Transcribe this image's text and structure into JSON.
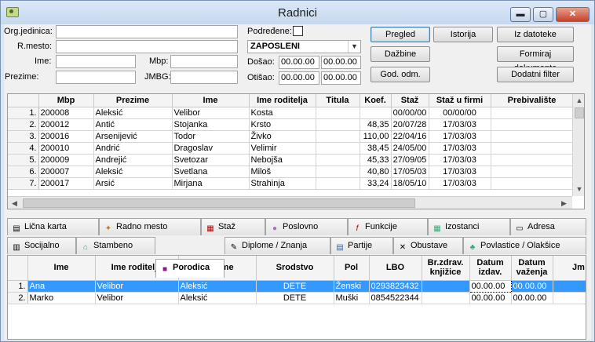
{
  "window": {
    "title": "Radnici",
    "min": "▬",
    "max": "▢",
    "close": "✕"
  },
  "filters": {
    "org_label": "Org.jedinica:",
    "org_value": "",
    "rmesto_label": "R.mesto:",
    "rmesto_value": "",
    "ime_label": "Ime:",
    "ime_value": "",
    "mbp_label": "Mbp:",
    "mbp_value": "",
    "prezime_label": "Prezime:",
    "prezime_value": "",
    "jmbg_label": "JMBG:",
    "jmbg_value": "",
    "podredjene_label": "Podređene:",
    "status_value": "ZAPOSLENI",
    "dosao_label": "Došao:",
    "dosao_from": "00.00.00",
    "dosao_to": "00.00.00",
    "otisao_label": "Otišao:",
    "otisao_from": "00.00.00",
    "otisao_to": "00.00.00"
  },
  "buttons": {
    "pregled": "Pregled",
    "istorija": "Istorija",
    "iz_datoteke": "Iz datoteke",
    "dazbine": "Dažbine",
    "formiraj": "Formiraj dokumente",
    "god_odm": "God. odm.",
    "dodatni": "Dodatni filter"
  },
  "main_table": {
    "headers": [
      "Mbp",
      "Prezime",
      "Ime",
      "Ime roditelja",
      "Titula",
      "Koef.",
      "Staž",
      "Staž u firmi",
      "Prebivalište"
    ],
    "rows": [
      {
        "n": "1.",
        "mbp": "200008",
        "prezime": "Aleksić",
        "ime": "Velibor",
        "roditelj": "Kosta",
        "titula": "",
        "koef": "",
        "staz": "00/00/00",
        "staz_firma": "00/00/00",
        "preb": ""
      },
      {
        "n": "2.",
        "mbp": "200012",
        "prezime": "Antić",
        "ime": "Stojanka",
        "roditelj": "Krsto",
        "titula": "",
        "koef": "48,35",
        "staz": "20/07/28",
        "staz_firma": "17/03/03",
        "preb": ""
      },
      {
        "n": "3.",
        "mbp": "200016",
        "prezime": "Arsenijević",
        "ime": "Todor",
        "roditelj": "Živko",
        "titula": "",
        "koef": "110,00",
        "staz": "22/04/16",
        "staz_firma": "17/03/03",
        "preb": ""
      },
      {
        "n": "4.",
        "mbp": "200010",
        "prezime": "Andrić",
        "ime": "Dragoslav",
        "roditelj": "Velimir",
        "titula": "",
        "koef": "38,45",
        "staz": "24/05/00",
        "staz_firma": "17/03/03",
        "preb": ""
      },
      {
        "n": "5.",
        "mbp": "200009",
        "prezime": "Andrejić",
        "ime": "Svetozar",
        "roditelj": "Nebojša",
        "titula": "",
        "koef": "45,33",
        "staz": "27/09/05",
        "staz_firma": "17/03/03",
        "preb": ""
      },
      {
        "n": "6.",
        "mbp": "200007",
        "prezime": "Aleksić",
        "ime": "Svetlana",
        "roditelj": "Miloš",
        "titula": "",
        "koef": "40,80",
        "staz": "17/05/03",
        "staz_firma": "17/03/03",
        "preb": ""
      },
      {
        "n": "7.",
        "mbp": "200017",
        "prezime": "Arsić",
        "ime": "Mirjana",
        "roditelj": "Strahinja",
        "titula": "",
        "koef": "33,24",
        "staz": "18/05/10",
        "staz_firma": "17/03/03",
        "preb": ""
      }
    ]
  },
  "tabs_row1": [
    "Lična karta",
    "Radno mesto",
    "Staž",
    "Poslovno",
    "Funkcije",
    "Izostanci",
    "Adresa"
  ],
  "tabs_row2": [
    "Socijalno",
    "Stambeno",
    "Porodica",
    "Diplome / Znanja",
    "Partije",
    "Obustave",
    "Povlastice / Olakšice"
  ],
  "family_table": {
    "headers": [
      "Ime",
      "Ime roditelja",
      "Prezime",
      "Srodstvo",
      "Pol",
      "LBO",
      "Br.zdrav. knjižice",
      "Datum izdav.",
      "Datum važenja",
      "Jm"
    ],
    "rows": [
      {
        "n": "1.",
        "ime": "Ana",
        "roditelj": "Velibor",
        "prezime": "Aleksić",
        "srodstvo": "DETE",
        "pol": "Ženski",
        "lbo": "0293823432",
        "knjizica": "",
        "izdav": "00.00.00",
        "vazenja": "00.00.00"
      },
      {
        "n": "2.",
        "ime": "Marko",
        "roditelj": "Velibor",
        "prezime": "Aleksić",
        "srodstvo": "DETE",
        "pol": "Muški",
        "lbo": "0854522344",
        "knjizica": "",
        "izdav": "00.00.00",
        "vazenja": "00.00.00"
      }
    ]
  }
}
